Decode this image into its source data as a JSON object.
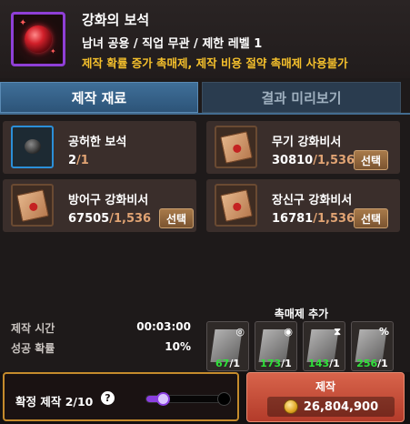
{
  "item": {
    "name": "강화의 보석",
    "info": "남녀 공용 / 직업 무관 / 제한 레벨 1",
    "warning": "제작 확률 증가 촉매제, 제작 비용 절약 촉매제 사용불가",
    "frame_color": "#8f3fd6"
  },
  "tabs": [
    {
      "label": "제작 재료",
      "active": true
    },
    {
      "label": "결과 미리보기",
      "active": false
    }
  ],
  "materials": [
    {
      "name": "공허한 보석",
      "have": "2",
      "need": "1",
      "select_label": null,
      "icon": "gem-icon"
    },
    {
      "name": "무기 강화비서",
      "have": "30810",
      "need": "1,536",
      "select_label": "선택",
      "icon": "scroll-icon"
    },
    {
      "name": "방어구 강화비서",
      "have": "67505",
      "need": "1,536",
      "select_label": "선택",
      "icon": "scroll-icon"
    },
    {
      "name": "장신구 강화비서",
      "have": "16781",
      "need": "1,536",
      "select_label": "선택",
      "icon": "scroll-icon"
    }
  ],
  "info": {
    "time_label": "제작 시간",
    "time_value": "00:03:00",
    "rate_label": "성공 확률",
    "rate_value": "10%"
  },
  "catalyst": {
    "title": "촉매제 추가",
    "slots": [
      {
        "count": "67",
        "max": "1"
      },
      {
        "count": "173",
        "max": "1"
      },
      {
        "count": "143",
        "max": "1"
      },
      {
        "count": "256",
        "max": "1"
      }
    ]
  },
  "guarantee": {
    "label": "확정 제작 2/10",
    "help": "?",
    "progress": 0.2
  },
  "craft": {
    "label": "제작",
    "cost": "26,804,900"
  }
}
